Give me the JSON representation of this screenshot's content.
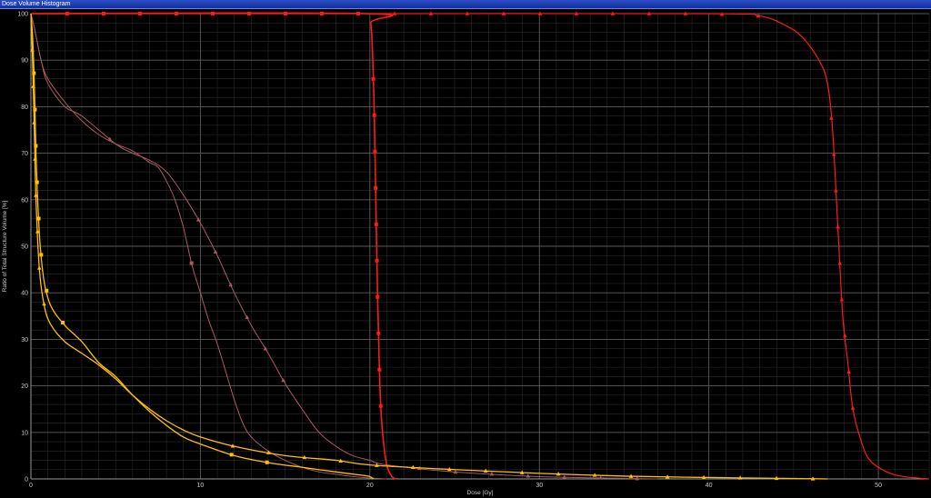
{
  "window": {
    "title": "Dose Volume Histogram"
  },
  "chart_data": {
    "type": "line",
    "title": "",
    "xlabel": "Dose [Gy]",
    "ylabel": "Ratio of Total Structure Volume [%]",
    "xlim": [
      0,
      53
    ],
    "ylim": [
      0,
      100
    ],
    "x_ticks": [
      10,
      20,
      30,
      40,
      50
    ],
    "y_ticks": [
      0,
      10,
      20,
      30,
      40,
      50,
      60,
      70,
      80,
      90,
      100
    ],
    "grid": true,
    "legend": "none",
    "series": [
      {
        "color": "#ff1a1a",
        "marker": "triangle",
        "width": 1.2,
        "points": [
          [
            0,
            100
          ],
          [
            20,
            100
          ],
          [
            40,
            100
          ],
          [
            43,
            99.5
          ],
          [
            44.5,
            97.5
          ],
          [
            45.5,
            95
          ],
          [
            46.5,
            90
          ],
          [
            47,
            85
          ],
          [
            47.3,
            75
          ],
          [
            47.6,
            55
          ],
          [
            47.9,
            35
          ],
          [
            48.2,
            25
          ],
          [
            48.5,
            15
          ],
          [
            49,
            8
          ],
          [
            49.5,
            4
          ],
          [
            50.5,
            1.5
          ],
          [
            51.5,
            0.5
          ],
          [
            53,
            0
          ]
        ]
      },
      {
        "color": "#ff1a1a",
        "marker": "square",
        "width": 1.6,
        "points": [
          [
            0,
            100
          ],
          [
            19.8,
            100
          ],
          [
            20.05,
            98
          ],
          [
            20.15,
            92
          ],
          [
            20.25,
            80
          ],
          [
            20.35,
            60
          ],
          [
            20.45,
            40
          ],
          [
            20.55,
            25
          ],
          [
            20.65,
            15
          ],
          [
            20.8,
            8
          ],
          [
            21,
            3
          ],
          [
            21.3,
            0.5
          ],
          [
            21.6,
            0
          ]
        ]
      },
      {
        "color": "#a85a62",
        "marker": "triangle",
        "width": 1.0,
        "points": [
          [
            0,
            100
          ],
          [
            0.2,
            97
          ],
          [
            0.6,
            90
          ],
          [
            1,
            85
          ],
          [
            2,
            80
          ],
          [
            3,
            78
          ],
          [
            5,
            72
          ],
          [
            6,
            70
          ],
          [
            7,
            68.5
          ],
          [
            8,
            66
          ],
          [
            9,
            61
          ],
          [
            10,
            55
          ],
          [
            11,
            48
          ],
          [
            12,
            40
          ],
          [
            13,
            33
          ],
          [
            14,
            27
          ],
          [
            15,
            20.5
          ],
          [
            16,
            15
          ],
          [
            17,
            10
          ],
          [
            18,
            7
          ],
          [
            19,
            5
          ],
          [
            20,
            4
          ],
          [
            21,
            3
          ],
          [
            25,
            1.5
          ],
          [
            30,
            0.5
          ],
          [
            37,
            0
          ]
        ]
      },
      {
        "color": "#a85a62",
        "marker": "square",
        "width": 1.0,
        "points": [
          [
            0,
            100
          ],
          [
            0.2,
            97
          ],
          [
            0.6,
            90
          ],
          [
            1,
            86
          ],
          [
            2,
            81
          ],
          [
            3,
            77
          ],
          [
            4,
            74
          ],
          [
            5,
            72
          ],
          [
            6,
            70.5
          ],
          [
            7,
            68
          ],
          [
            7.5,
            67
          ],
          [
            8,
            64
          ],
          [
            8.5,
            60
          ],
          [
            9,
            54
          ],
          [
            9.5,
            46
          ],
          [
            10,
            40
          ],
          [
            10.5,
            34
          ],
          [
            11,
            29
          ],
          [
            11.5,
            23
          ],
          [
            12,
            17
          ],
          [
            12.5,
            12
          ],
          [
            13,
            9
          ],
          [
            14,
            6
          ],
          [
            15,
            4
          ],
          [
            16,
            2.5
          ],
          [
            17,
            1.5
          ],
          [
            18,
            1
          ],
          [
            19,
            0.5
          ],
          [
            20,
            0.2
          ],
          [
            21,
            0
          ]
        ]
      },
      {
        "color": "#ffc000",
        "marker": "triangle",
        "width": 1.3,
        "points": [
          [
            0,
            100
          ],
          [
            0.1,
            90
          ],
          [
            0.2,
            75
          ],
          [
            0.3,
            60
          ],
          [
            0.5,
            45
          ],
          [
            0.8,
            37
          ],
          [
            1.2,
            33
          ],
          [
            2,
            29.5
          ],
          [
            3,
            27
          ],
          [
            4,
            24.5
          ],
          [
            5,
            21.5
          ],
          [
            6,
            18
          ],
          [
            7,
            15
          ],
          [
            8,
            12.5
          ],
          [
            9,
            10.5
          ],
          [
            10,
            9
          ],
          [
            12,
            7
          ],
          [
            15,
            5
          ],
          [
            18,
            4
          ],
          [
            20,
            3
          ],
          [
            25,
            2
          ],
          [
            30,
            1.2
          ],
          [
            35,
            0.6
          ],
          [
            40,
            0.3
          ],
          [
            45,
            0.1
          ],
          [
            47,
            0
          ]
        ]
      },
      {
        "color": "#ffc000",
        "marker": "square",
        "width": 1.3,
        "points": [
          [
            0,
            100
          ],
          [
            0.1,
            95
          ],
          [
            0.2,
            85
          ],
          [
            0.3,
            70
          ],
          [
            0.4,
            60
          ],
          [
            0.55,
            50
          ],
          [
            0.8,
            42
          ],
          [
            1.2,
            37
          ],
          [
            2,
            33
          ],
          [
            3,
            29.5
          ],
          [
            4,
            25
          ],
          [
            5,
            22
          ],
          [
            6,
            18
          ],
          [
            7,
            14.5
          ],
          [
            8,
            11.5
          ],
          [
            9,
            9
          ],
          [
            10,
            7.5
          ],
          [
            12,
            5
          ],
          [
            14,
            3.5
          ],
          [
            16,
            2.5
          ],
          [
            18,
            1.5
          ],
          [
            19.5,
            0.8
          ],
          [
            20,
            0.5
          ],
          [
            20.2,
            0
          ]
        ]
      }
    ]
  }
}
